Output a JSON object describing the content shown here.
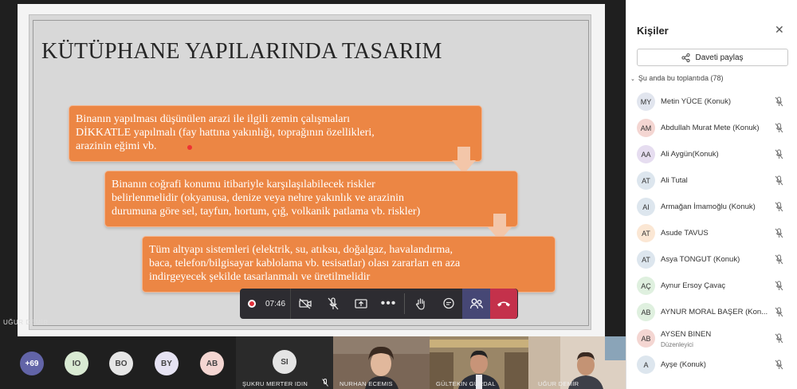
{
  "slide": {
    "title": "KÜTÜPHANE YAPILARINDA TASARIM",
    "box1": [
      "Binanın yapılması düşünülen arazi ile ilgili zemin çalışmaları",
      "DİKKATLE yapılmalı (fay hattına yakınlığı, toprağının özellikleri,",
      "arazinin eğimi vb."
    ],
    "box2": [
      "Binanın coğrafi konumu itibariyle karşılaşılabilecek riskler",
      "belirlenmelidir (okyanusa, denize veya nehre yakınlık ve arazinin",
      "durumuna göre sel, tayfun, hortum, çığ, volkanik patlama vb. riskler)"
    ],
    "box3": [
      "Tüm altyapı sistemleri (elektrik, su, atıksu, doğalgaz, havalandırma,",
      "baca, telefon/bilgisayar kablolama vb. tesisatlar) olası zararları en aza",
      "indirgeyecek şekilde tasarlanmalı ve üretilmelidir"
    ],
    "presenter": "UĞUR DEMİR"
  },
  "controls": {
    "timer": "07:46",
    "icons": [
      "record-icon",
      "camera-off-icon",
      "mic-off-icon",
      "share-screen-icon",
      "more-icon",
      "raise-hand-icon",
      "chat-icon",
      "people-icon",
      "hang-up-icon"
    ]
  },
  "panel": {
    "title": "Kişiler",
    "share_label": "Daveti paylaş",
    "section_label": "Şu anda bu toplantıda (78)",
    "people": [
      {
        "initials": "MY",
        "name": "Metin YÜCE (Konuk)",
        "color": "#e1e5ee"
      },
      {
        "initials": "AM",
        "name": "Abdullah Murat Mete (Konuk)",
        "color": "#f4d6d2"
      },
      {
        "initials": "AA",
        "name": "Ali Aygün(Konuk)",
        "color": "#e6ddf0"
      },
      {
        "initials": "AT",
        "name": "Ali Tutal",
        "color": "#dde6ee"
      },
      {
        "initials": "AI",
        "name": "Armağan İmamoğlu (Konuk)",
        "color": "#dde6ee"
      },
      {
        "initials": "AT",
        "name": "Asude TAVUS",
        "color": "#fbe7d4"
      },
      {
        "initials": "AT",
        "name": "Asya TONGUT (Konuk)",
        "color": "#dde6ee"
      },
      {
        "initials": "AÇ",
        "name": "Aynur Ersoy Çavaç",
        "color": "#dff0df"
      },
      {
        "initials": "AB",
        "name": "AYNUR MORAL BAŞER (Kon...",
        "color": "#dff0df"
      },
      {
        "initials": "AB",
        "name": "AYSEN BINEN",
        "sub": "Düzenleyici",
        "color": "#f4d6d2"
      },
      {
        "initials": "A",
        "name": "Ayşe (Konuk)",
        "color": "#dde6ee"
      }
    ]
  },
  "bottom": {
    "bubbles": [
      {
        "label": "+69",
        "color": "#6264a7",
        "text_color": "#ffffff"
      },
      {
        "label": "IO",
        "color": "#d9ead3",
        "text_color": "#444444"
      },
      {
        "label": "BO",
        "color": "#e6e6e6",
        "text_color": "#444444"
      },
      {
        "label": "BY",
        "color": "#e6e3f3",
        "text_color": "#444444"
      },
      {
        "label": "AB",
        "color": "#f4d6d2",
        "text_color": "#444444"
      }
    ],
    "tiles": [
      {
        "initials": "SI",
        "name": "ŞUKRU MERTER IDIN"
      },
      {
        "name": "NURHAN ECEMIS"
      },
      {
        "name": "GÜLTEKIN GÜRDAL"
      },
      {
        "name": "UĞUR DEMİR"
      }
    ]
  }
}
